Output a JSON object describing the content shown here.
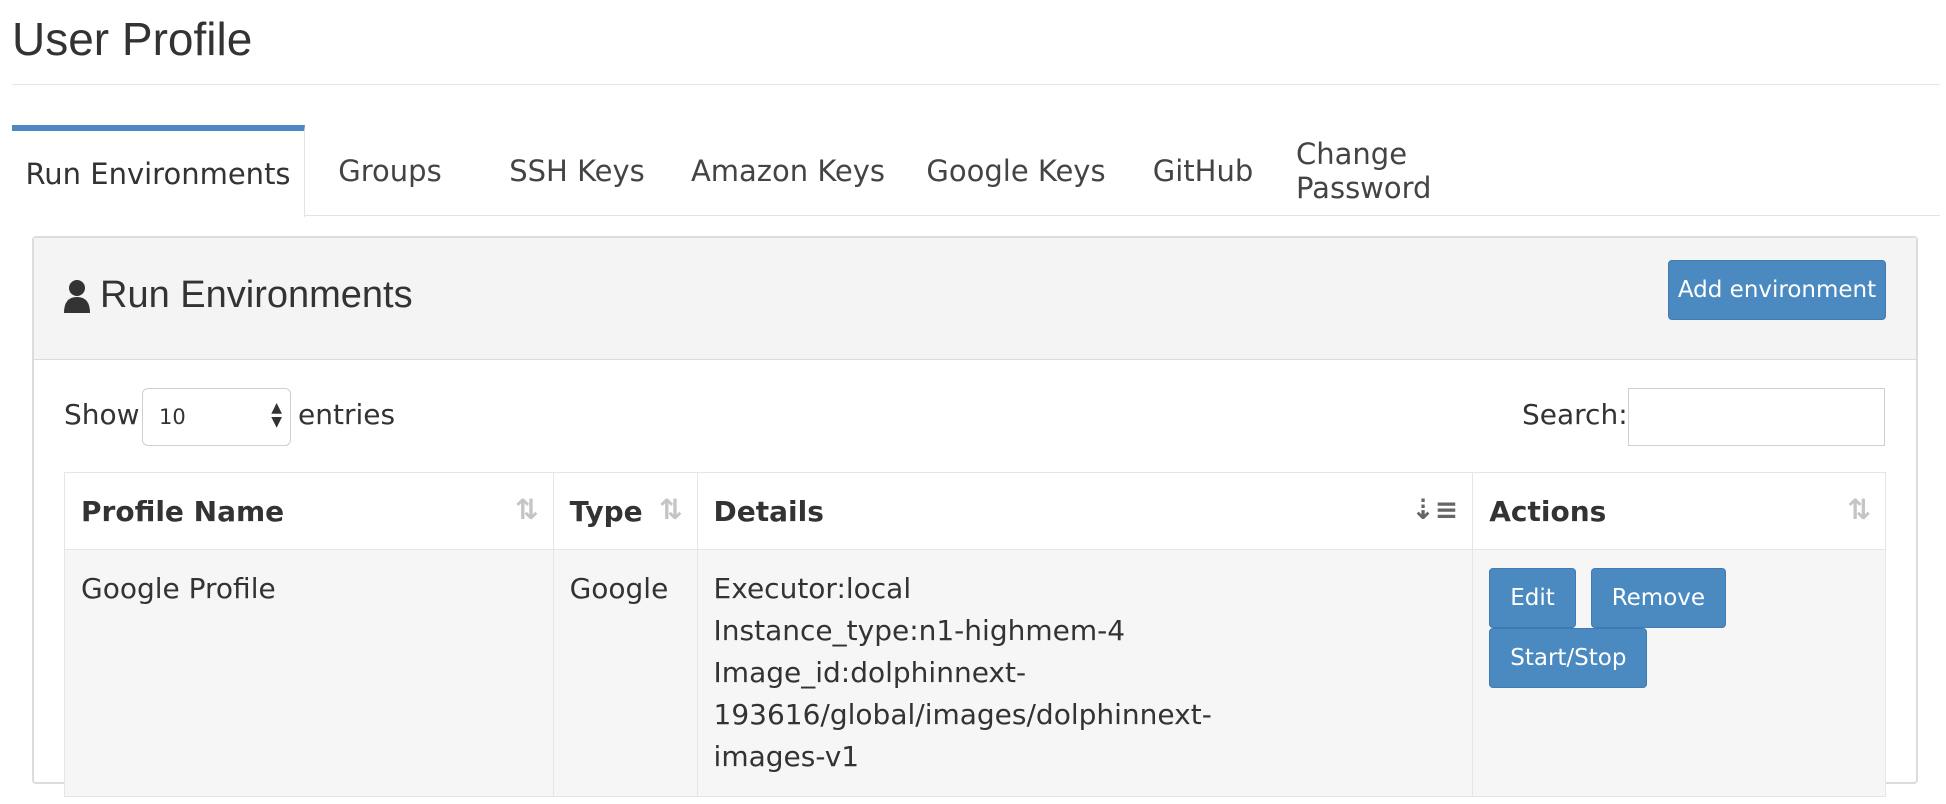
{
  "page": {
    "title": "User Profile"
  },
  "tabs": [
    {
      "label": "Run Environments",
      "active": true
    },
    {
      "label": "Groups"
    },
    {
      "label": "SSH Keys"
    },
    {
      "label": "Amazon Keys"
    },
    {
      "label": "Google Keys"
    },
    {
      "label": "GitHub"
    },
    {
      "label": "Change Password"
    }
  ],
  "panel": {
    "title": "Run Environments",
    "icon": "user-icon",
    "add_button": "Add environment"
  },
  "controls": {
    "show_label": "Show",
    "entries_value": "10",
    "entries_label": "entries",
    "search_label": "Search:",
    "search_value": ""
  },
  "table": {
    "columns": [
      "Profile Name",
      "Type",
      "Details",
      "Actions"
    ],
    "rows": [
      {
        "profile_name": "Google Profile",
        "type": "Google",
        "details": [
          "Executor:local",
          "Instance_type:n1-highmem-4",
          "Image_id:dolphinnext-193616/global/images/dolphinnext-",
          "images-v1"
        ],
        "actions": [
          "Edit",
          "Remove",
          "Start/Stop"
        ]
      }
    ]
  },
  "colors": {
    "accent": "#4a8ac0"
  }
}
